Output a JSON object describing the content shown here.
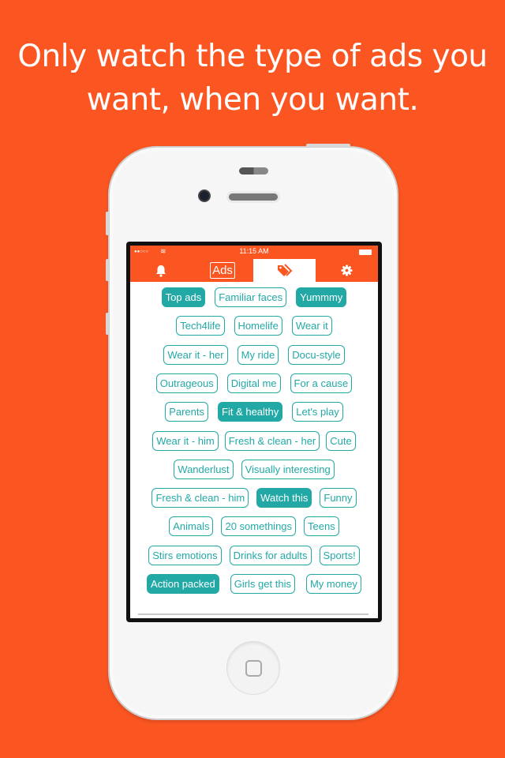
{
  "headline": [
    "Only watch the type of ads you",
    "want, when you want."
  ],
  "status_bar": {
    "time": "11:15 AM"
  },
  "tabs": [
    {
      "icon": "bell-icon"
    },
    {
      "label": "Ads"
    },
    {
      "icon": "tag-icon",
      "selected": true
    },
    {
      "icon": "gear-icon"
    }
  ],
  "colors": {
    "background": "#fb5622",
    "accent": "#22a9a6"
  },
  "tag_rows": [
    [
      {
        "label": "Top ads",
        "on": true
      },
      {
        "label": "Familiar faces",
        "on": false
      },
      {
        "label": "Yummmy",
        "on": true
      }
    ],
    [
      {
        "label": "Tech4life",
        "on": false
      },
      {
        "label": "Homelife",
        "on": false
      },
      {
        "label": "Wear it",
        "on": false
      }
    ],
    [
      {
        "label": "Wear it - her",
        "on": false
      },
      {
        "label": "My ride",
        "on": false
      },
      {
        "label": "Docu-style",
        "on": false
      }
    ],
    [
      {
        "label": "Outrageous",
        "on": false
      },
      {
        "label": "Digital me",
        "on": false
      },
      {
        "label": "For a cause",
        "on": false
      }
    ],
    [
      {
        "label": "Parents",
        "on": false
      },
      {
        "label": "Fit & healthy",
        "on": true
      },
      {
        "label": "Let's play",
        "on": false
      }
    ],
    [
      {
        "label": "Wear it - him",
        "on": false
      },
      {
        "label": "Fresh & clean - her",
        "on": false
      },
      {
        "label": "Cute",
        "on": false
      }
    ],
    [
      {
        "label": "Wanderlust",
        "on": false
      },
      {
        "label": "Visually interesting",
        "on": false
      }
    ],
    [
      {
        "label": "Fresh & clean - him",
        "on": false
      },
      {
        "label": "Watch this",
        "on": true
      },
      {
        "label": "Funny",
        "on": false
      }
    ],
    [
      {
        "label": "Animals",
        "on": false
      },
      {
        "label": "20 somethings",
        "on": false
      },
      {
        "label": "Teens",
        "on": false
      }
    ],
    [
      {
        "label": "Stirs emotions",
        "on": false
      },
      {
        "label": "Drinks for adults",
        "on": false
      },
      {
        "label": "Sports!",
        "on": false
      }
    ],
    [
      {
        "label": "Action packed",
        "on": true
      },
      {
        "label": "Girls get this",
        "on": false
      },
      {
        "label": "My money",
        "on": false
      }
    ]
  ]
}
